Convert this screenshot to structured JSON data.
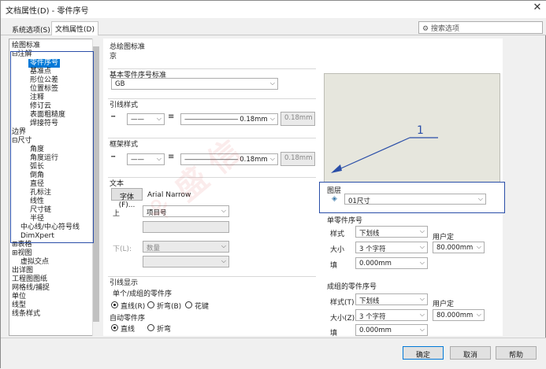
{
  "window": {
    "title": "文档属性(D) - 零件序号",
    "close": "✕"
  },
  "tabs": [
    {
      "label": "系统选项(S)"
    },
    {
      "label": "文档属性(D)"
    }
  ],
  "search": {
    "placeholder": "搜索选项"
  },
  "tree": [
    "绘图标准",
    "注解",
    "零件序号",
    "基准点",
    "形位公差",
    "位置标签",
    "注释",
    "修订云",
    "表面粗糙度",
    "焊接符号",
    "边界",
    "尺寸",
    "角度",
    "角度运行",
    "弧长",
    "倒角",
    "直径",
    "孔标注",
    "线性",
    "尺寸链",
    "半径",
    "中心线/中心符号线",
    "DimXpert",
    "表格",
    "视图",
    "虚拟交点",
    "出详图",
    "工程图图纸",
    "网格线/捕捉",
    "单位",
    "线型",
    "线条样式"
  ],
  "main": {
    "overall_label": "总绘图标准",
    "overall_value": "京",
    "base_std_label": "基本零件序号标准",
    "base_std_value": "GB",
    "leader_style_label": "引线样式",
    "leader_thickness": "0.18mm",
    "leader_custom": "0.18mm",
    "frame_style_label": "框架样式",
    "frame_thickness": "0.18mm",
    "frame_custom": "0.18mm",
    "text_label": "文本",
    "font_button": "字体(F)...",
    "font_name": "Arial Narrow",
    "upper_label": "上",
    "upper_value": "项目号",
    "lower_label": "下(L):",
    "lower_value": "数量",
    "leader_display_label": "引线显示",
    "single_label": "单个/成组的零件序",
    "r_straight": "直线(R)",
    "r_bent": "折弯(B)",
    "r_spline": "花键",
    "auto_label": "自动零件序",
    "r2_straight": "直线",
    "r2_bent": "折弯"
  },
  "right": {
    "callout": "1",
    "layer_label": "图层",
    "layer_value": "01尺寸",
    "single_title": "单零件序号",
    "style_label": "样式",
    "style_value": "下划线",
    "size_label": "大小",
    "size_value": "3 个字符",
    "user_def": "用户定",
    "user_value": "80.000mm",
    "fill_label": "填",
    "fill_value": "0.000mm",
    "group_title": "成组的零件序号",
    "g_style_label": "样式(T)",
    "g_style_value": "下划线",
    "g_size_label": "大小(Z)",
    "g_size_value": "3 个字符",
    "g_user_def": "用户定",
    "g_user_value": "80.000mm",
    "g_fill_label": "填",
    "g_fill_value": "0.000mm"
  },
  "buttons": {
    "ok": "确定",
    "cancel": "取消",
    "help": "帮助"
  }
}
